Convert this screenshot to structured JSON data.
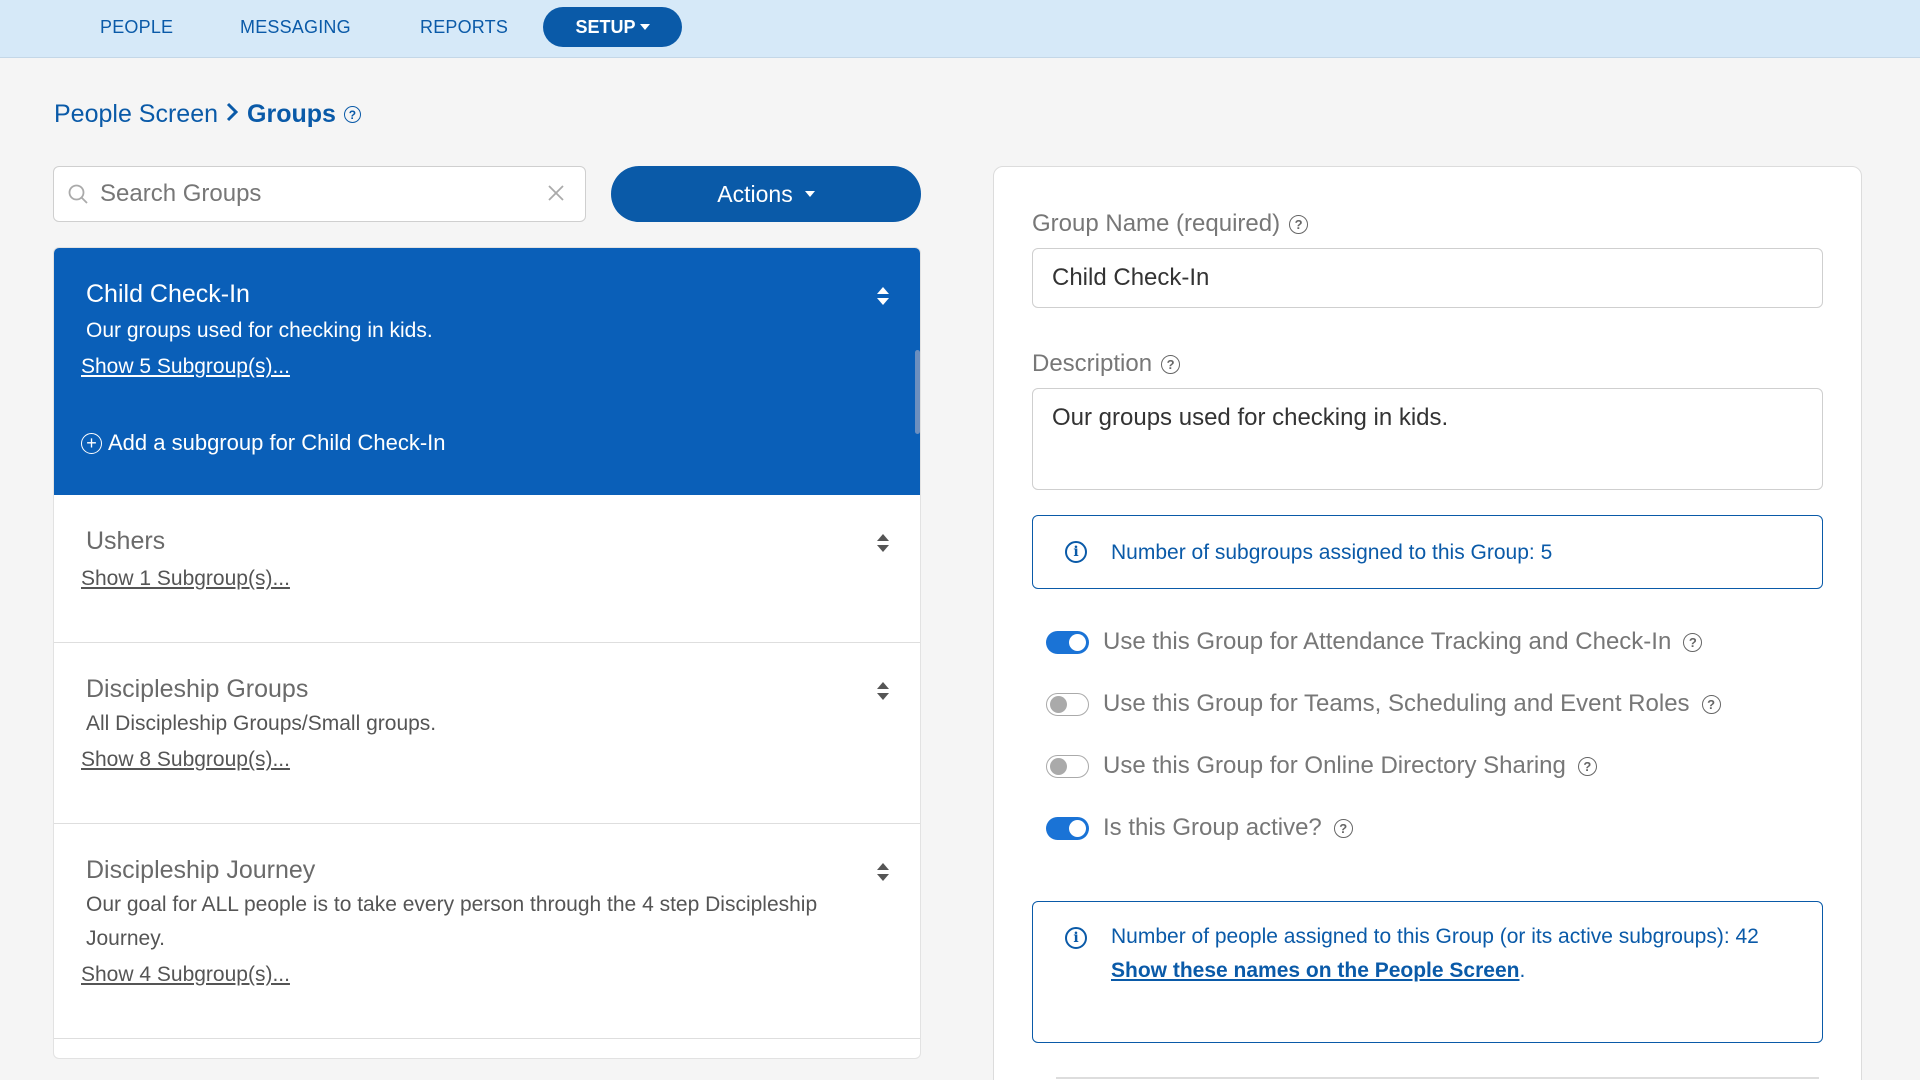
{
  "nav": {
    "items": [
      "PEOPLE",
      "MESSAGING",
      "REPORTS"
    ],
    "setup_label": "SETUP"
  },
  "breadcrumb": {
    "parent": "People Screen",
    "current": "Groups"
  },
  "search": {
    "placeholder": "Search Groups",
    "value": ""
  },
  "actions": {
    "label": "Actions"
  },
  "groups": [
    {
      "title": "Child Check-In",
      "description": "Our groups used for checking in kids.",
      "subgroups_link": "Show 5 Subgroup(s)...",
      "add_subgroup": "Add a subgroup for Child Check-In",
      "selected": true
    },
    {
      "title": "Ushers",
      "description": "",
      "subgroups_link": "Show 1 Subgroup(s)..."
    },
    {
      "title": "Discipleship Groups",
      "description": "All Discipleship Groups/Small groups.",
      "subgroups_link": "Show 8 Subgroup(s)..."
    },
    {
      "title": "Discipleship Journey",
      "description": "Our goal for ALL people is to take every person through the 4 step Discipleship Journey.",
      "subgroups_link": "Show 4 Subgroup(s)..."
    }
  ],
  "form": {
    "group_name_label": "Group Name (required)",
    "group_name_value": "Child Check-In",
    "description_label": "Description",
    "description_value": "Our groups used for checking in kids.",
    "subgroups_info": "Number of subgroups assigned to this Group: 5",
    "toggles": [
      {
        "label": "Use this Group for Attendance Tracking and Check-In",
        "on": true
      },
      {
        "label": "Use this Group for Teams, Scheduling and Event Roles",
        "on": false
      },
      {
        "label": "Use this Group for Online Directory Sharing",
        "on": false
      },
      {
        "label": "Is this Group active?",
        "on": true
      }
    ],
    "people_info": "Number of people assigned to this Group (or its active subgroups): 42",
    "people_link": "Show these names on the People Screen",
    "people_link_suffix": "."
  },
  "colors": {
    "primary": "#0a5aa8",
    "selected_row": "#0a5fb8",
    "nav_bg": "#d6e9f8",
    "toggle_on": "#1a73d6"
  }
}
